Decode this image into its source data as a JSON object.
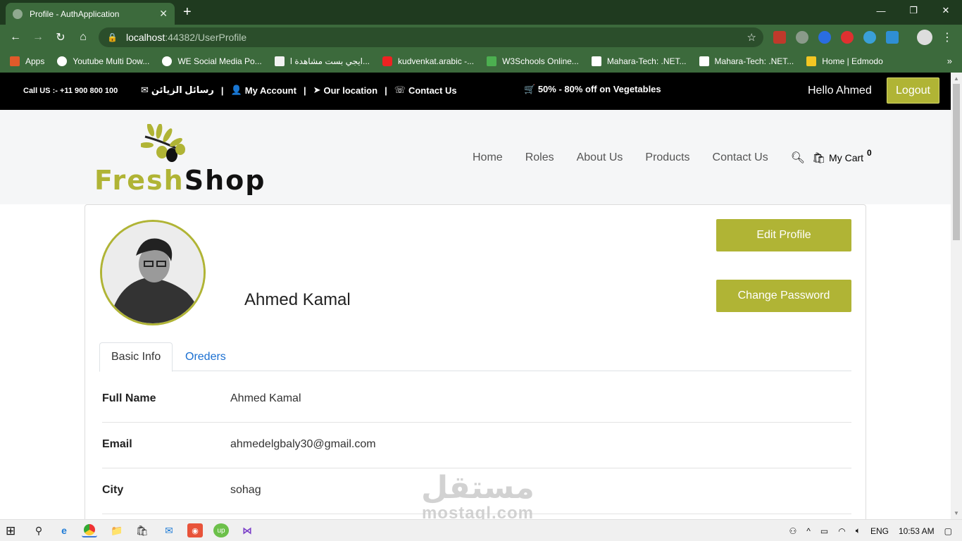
{
  "browser": {
    "tab_title": "Profile - AuthApplication",
    "new_tab": "+",
    "url_host": "localhost",
    "url_path": ":44382/UserProfile",
    "bookmarks": [
      "Apps",
      "Youtube Multi Dow...",
      "WE Social Media Po...",
      "ايجي بست مشاهدة ا...",
      "kudvenkat.arabic -...",
      "W3Schools Online...",
      "Mahara-Tech: .NET...",
      "Mahara-Tech: .NET...",
      "Home | Edmodo"
    ],
    "bookmarks_more": "»"
  },
  "topbar": {
    "call_us": "Call US :- +11 900 800 100",
    "messages": "رسائل الزيائن",
    "my_account": "My Account",
    "our_location": "Our location",
    "contact_us": "Contact Us",
    "promo": "50% - 80% off on Vegetables",
    "hello": "Hello Ahmed",
    "logout": "Logout"
  },
  "header": {
    "brand_part1": "Fresh",
    "brand_part2": "Shop",
    "nav": [
      "Home",
      "Roles",
      "About Us",
      "Products",
      "Contact Us"
    ],
    "cart_label": "My Cart",
    "cart_count": "0"
  },
  "profile": {
    "name": "Ahmed Kamal",
    "edit_button": "Edit Profile",
    "change_password_button": "Change Password",
    "tabs": [
      "Basic Info",
      "Oreders"
    ],
    "fields": [
      {
        "label": "Full Name",
        "value": "Ahmed Kamal"
      },
      {
        "label": "Email",
        "value": "ahmedelgbaly30@gmail.com"
      },
      {
        "label": "City",
        "value": "sohag"
      }
    ]
  },
  "watermark": {
    "arabic": "مستقل",
    "latin": "mostaql.com"
  },
  "taskbar": {
    "language": "ENG",
    "time": "10:53 AM"
  },
  "colors": {
    "accent": "#b0b435",
    "chrome": "#3c6a3c",
    "link": "#1a6fd1"
  }
}
